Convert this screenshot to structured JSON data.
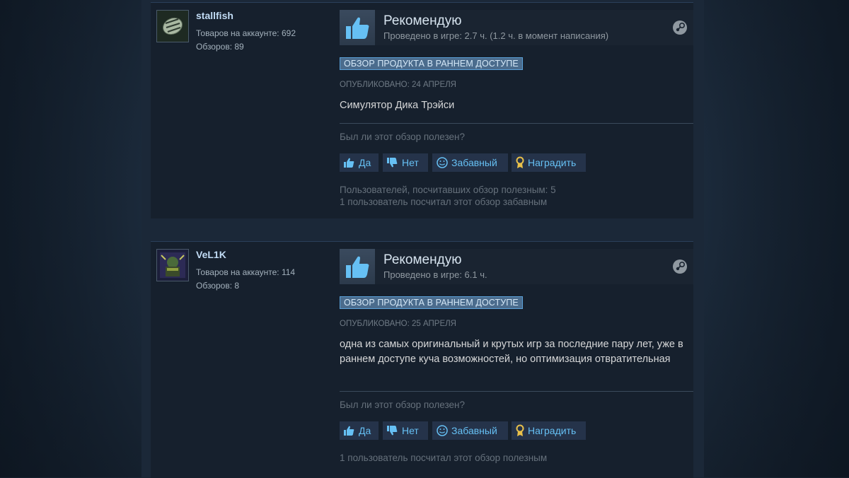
{
  "reviews": [
    {
      "user": {
        "name": "stallfish",
        "products": "Товаров на аккаунте: 692",
        "reviews": "Обзоров: 89"
      },
      "verdict": "Рекомендую",
      "hours": "Проведено в игре: 2.7 ч. (1.2 ч. в момент написания)",
      "badge": "ОБЗОР ПРОДУКТА В РАННЕМ ДОСТУПЕ",
      "posted": "ОПУБЛИКОВАНО: 24 АПРЕЛЯ",
      "text": "Симулятор Дика Трэйси",
      "helpful_question": "Был ли этот обзор полезен?",
      "buttons": {
        "yes": "Да",
        "no": "Нет",
        "funny": "Забавный",
        "award": "Наградить"
      },
      "counts": [
        "Пользователей, посчитавших обзор полезным: 5",
        "1 пользователь посчитал этот обзор забавным"
      ]
    },
    {
      "user": {
        "name": "VeL1K",
        "products": "Товаров на аккаунте: 114",
        "reviews": "Обзоров: 8"
      },
      "verdict": "Рекомендую",
      "hours": "Проведено в игре: 6.1 ч.",
      "badge": "ОБЗОР ПРОДУКТА В РАННЕМ ДОСТУПЕ",
      "posted": "ОПУБЛИКОВАНО: 25 АПРЕЛЯ",
      "text": "одна из самых оригинальный и крутых игр за последние пару лет, уже в раннем доступе куча возможностей, но оптимизация отвратительная",
      "helpful_question": "Был ли этот обзор полезен?",
      "buttons": {
        "yes": "Да",
        "no": "Нет",
        "funny": "Забавный",
        "award": "Наградить"
      },
      "counts": [
        "1 пользователь посчитал этот обзор полезным"
      ]
    }
  ],
  "colors": {
    "accent": "#66c0f4",
    "badge": "#4b6c8d",
    "panel": "#16202d"
  },
  "icons": [
    "thumbs-up-icon",
    "thumbs-down-icon",
    "smiley-icon",
    "award-icon",
    "steam-icon"
  ]
}
